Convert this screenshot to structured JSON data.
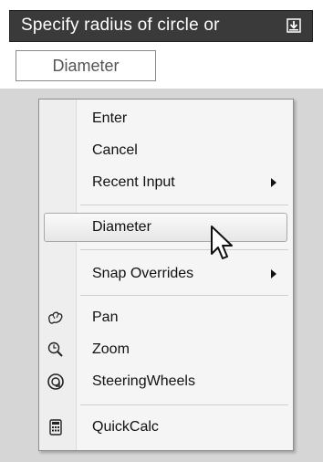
{
  "command_line": {
    "prompt_text": "Specify radius of circle or",
    "options_icon": "dropdown-arrow-icon"
  },
  "option_button": {
    "label": "Diameter"
  },
  "context_menu": {
    "items": [
      {
        "label": "Enter",
        "icon": null,
        "submenu": false
      },
      {
        "label": "Cancel",
        "icon": null,
        "submenu": false
      },
      {
        "label": "Recent Input",
        "icon": null,
        "submenu": true
      },
      {
        "label": "Diameter",
        "icon": null,
        "submenu": false,
        "highlighted": true
      },
      {
        "label": "Snap Overrides",
        "icon": null,
        "submenu": true
      },
      {
        "label": "Pan",
        "icon": "pan-hand-icon",
        "submenu": false
      },
      {
        "label": "Zoom",
        "icon": "zoom-icon",
        "submenu": false
      },
      {
        "label": "SteeringWheels",
        "icon": "steering-wheel-icon",
        "submenu": false
      },
      {
        "label": "QuickCalc",
        "icon": "calculator-icon",
        "submenu": false
      }
    ]
  },
  "colors": {
    "prompt_bg": "#3a3a3a",
    "menu_bg": "#f5f5f5",
    "page_bg": "#d6d6d6"
  }
}
